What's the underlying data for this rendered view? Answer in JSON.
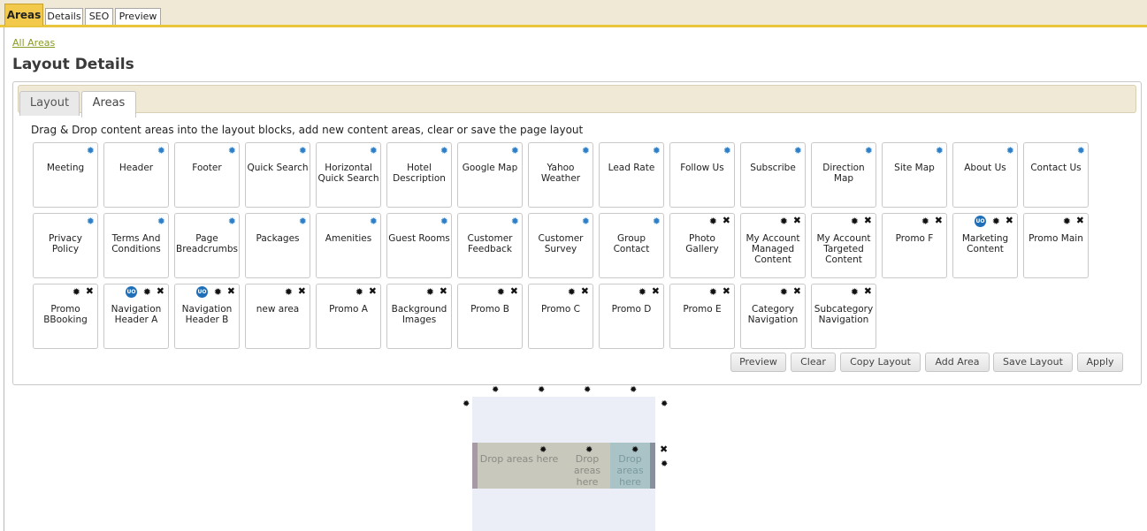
{
  "top_tabs": [
    {
      "label": "Areas",
      "active": true
    },
    {
      "label": "Details",
      "active": false
    },
    {
      "label": "SEO",
      "active": false
    },
    {
      "label": "Preview",
      "active": false
    }
  ],
  "breadcrumb": "All Areas",
  "page_title": "Layout Details",
  "sub_tabs": [
    {
      "label": "Layout",
      "active": false
    },
    {
      "label": "Areas",
      "active": true
    }
  ],
  "instructions": "Drag & Drop content areas into the layout blocks, add new content areas, clear or save the page layout",
  "areas": [
    {
      "label": "Meeting",
      "type": "system"
    },
    {
      "label": "Header",
      "type": "system"
    },
    {
      "label": "Footer",
      "type": "system"
    },
    {
      "label": "Quick Search",
      "type": "system"
    },
    {
      "label": "Horizontal Quick Search",
      "type": "system"
    },
    {
      "label": "Hotel Description",
      "type": "system"
    },
    {
      "label": "Google Map",
      "type": "system"
    },
    {
      "label": "Yahoo Weather",
      "type": "system"
    },
    {
      "label": "Lead Rate",
      "type": "system"
    },
    {
      "label": "Follow Us",
      "type": "system"
    },
    {
      "label": "Subscribe",
      "type": "system"
    },
    {
      "label": "Direction Map",
      "type": "system"
    },
    {
      "label": "Site Map",
      "type": "system"
    },
    {
      "label": "About Us",
      "type": "system"
    },
    {
      "label": "Contact Us",
      "type": "system"
    },
    {
      "label": "Privacy Policy",
      "type": "system"
    },
    {
      "label": "Terms And Conditions",
      "type": "system"
    },
    {
      "label": "Page Breadcrumbs",
      "type": "system"
    },
    {
      "label": "Packages",
      "type": "system"
    },
    {
      "label": "Amenities",
      "type": "system"
    },
    {
      "label": "Guest Rooms",
      "type": "system"
    },
    {
      "label": "Customer Feedback",
      "type": "system"
    },
    {
      "label": "Customer Survey",
      "type": "system"
    },
    {
      "label": "Group Contact",
      "type": "system"
    },
    {
      "label": "Photo Gallery",
      "type": "custom"
    },
    {
      "label": "My Account Managed Content",
      "type": "custom"
    },
    {
      "label": "My Account Targeted Content",
      "type": "custom"
    },
    {
      "label": "Promo F",
      "type": "custom"
    },
    {
      "label": "Marketing Content",
      "type": "custom",
      "badge": "UO"
    },
    {
      "label": "Promo Main",
      "type": "custom"
    },
    {
      "label": "Promo BBooking",
      "type": "custom"
    },
    {
      "label": "Navigation Header A",
      "type": "custom",
      "badge": "UO"
    },
    {
      "label": "Navigation Header B",
      "type": "custom",
      "badge": "UO"
    },
    {
      "label": "new area",
      "type": "custom"
    },
    {
      "label": "Promo A",
      "type": "custom"
    },
    {
      "label": "Background Images",
      "type": "custom"
    },
    {
      "label": "Promo B",
      "type": "custom"
    },
    {
      "label": "Promo C",
      "type": "custom"
    },
    {
      "label": "Promo D",
      "type": "custom"
    },
    {
      "label": "Promo E",
      "type": "custom"
    },
    {
      "label": "Category Navigation",
      "type": "custom"
    },
    {
      "label": "Subcategory Navigation",
      "type": "custom"
    }
  ],
  "buttons": {
    "preview": "Preview",
    "clear": "Clear",
    "copy_layout": "Copy Layout",
    "add_area": "Add Area",
    "save_layout": "Save Layout",
    "apply": "Apply"
  },
  "layout_preview": {
    "drop_cells": [
      "Drop areas here",
      "Drop areas here",
      "Drop areas here"
    ]
  },
  "colors": {
    "accent_tab": "#f2c94a",
    "tab_bar_border": "#e8c53a",
    "link": "#8a9a26",
    "gear_blue": "#2f7fc6",
    "badge_blue": "#1f6fb8",
    "canvas_bg": "#eceef7",
    "drop_row": "#c8c8bc",
    "drop_selected": "#a9c3c6"
  },
  "icons": {
    "settings": "gear-icon",
    "remove": "close-icon"
  }
}
